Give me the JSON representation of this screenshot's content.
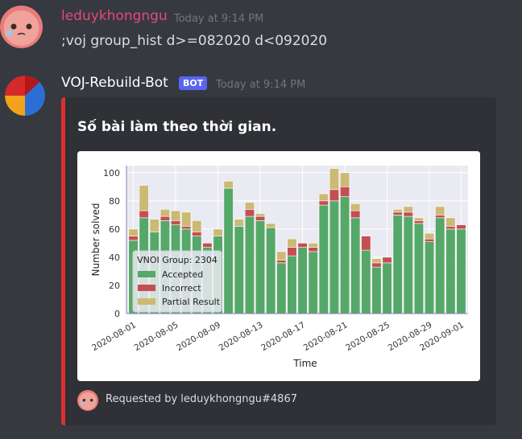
{
  "messages": [
    {
      "author": "leduykhongngu",
      "timestamp": "Today at 9:14 PM",
      "text": ";voj group_hist d>=082020 d<092020"
    },
    {
      "author": "VOJ-Rebuild-Bot",
      "badge": "BOT",
      "timestamp": "Today at 9:14 PM"
    }
  ],
  "embed": {
    "title": "Số bài làm theo thời gian.",
    "footer": "Requested by leduykhongngu#4867",
    "accent_color": "#e02e2e"
  },
  "chart_data": {
    "type": "bar",
    "stacked": true,
    "xlabel": "Time",
    "ylabel": "Number solved",
    "ylim": [
      0,
      105
    ],
    "yticks": [
      0,
      20,
      40,
      60,
      80,
      100
    ],
    "xticks": [
      "2020-08-01",
      "2020-08-05",
      "2020-08-09",
      "2020-08-13",
      "2020-08-17",
      "2020-08-21",
      "2020-08-25",
      "2020-08-29",
      "2020-09-01"
    ],
    "legend_title": "VNOI Group: 2304",
    "legend_position": "lower-left",
    "grid": true,
    "colors": {
      "Accepted": "#55a868",
      "Incorrect": "#c44e52",
      "Partial Result": "#ccb974"
    },
    "categories": [
      "2020-08-01",
      "2020-08-02",
      "2020-08-03",
      "2020-08-04",
      "2020-08-05",
      "2020-08-06",
      "2020-08-07",
      "2020-08-08",
      "2020-08-09",
      "2020-08-10",
      "2020-08-11",
      "2020-08-12",
      "2020-08-13",
      "2020-08-14",
      "2020-08-15",
      "2020-08-16",
      "2020-08-17",
      "2020-08-18",
      "2020-08-19",
      "2020-08-20",
      "2020-08-21",
      "2020-08-22",
      "2020-08-23",
      "2020-08-24",
      "2020-08-25",
      "2020-08-26",
      "2020-08-27",
      "2020-08-28",
      "2020-08-29",
      "2020-08-30",
      "2020-08-31",
      "2020-09-01"
    ],
    "series": [
      {
        "name": "Accepted",
        "values": [
          52,
          68,
          58,
          66,
          63,
          60,
          55,
          47,
          55,
          89,
          62,
          69,
          66,
          61,
          36,
          41,
          47,
          44,
          77,
          80,
          83,
          68,
          45,
          33,
          36,
          70,
          69,
          64,
          51,
          68,
          60,
          60
        ]
      },
      {
        "name": "Incorrect",
        "values": [
          3,
          5,
          0,
          3,
          3,
          2,
          3,
          3,
          0,
          0,
          0,
          5,
          3,
          0,
          2,
          6,
          3,
          3,
          3,
          8,
          7,
          5,
          10,
          3,
          4,
          2,
          3,
          2,
          2,
          2,
          2,
          3
        ]
      },
      {
        "name": "Partial Result",
        "values": [
          5,
          18,
          9,
          5,
          7,
          10,
          8,
          0,
          5,
          5,
          5,
          5,
          2,
          3,
          6,
          6,
          0,
          3,
          5,
          15,
          10,
          5,
          0,
          3,
          0,
          2,
          4,
          2,
          4,
          6,
          6,
          0
        ]
      }
    ]
  }
}
